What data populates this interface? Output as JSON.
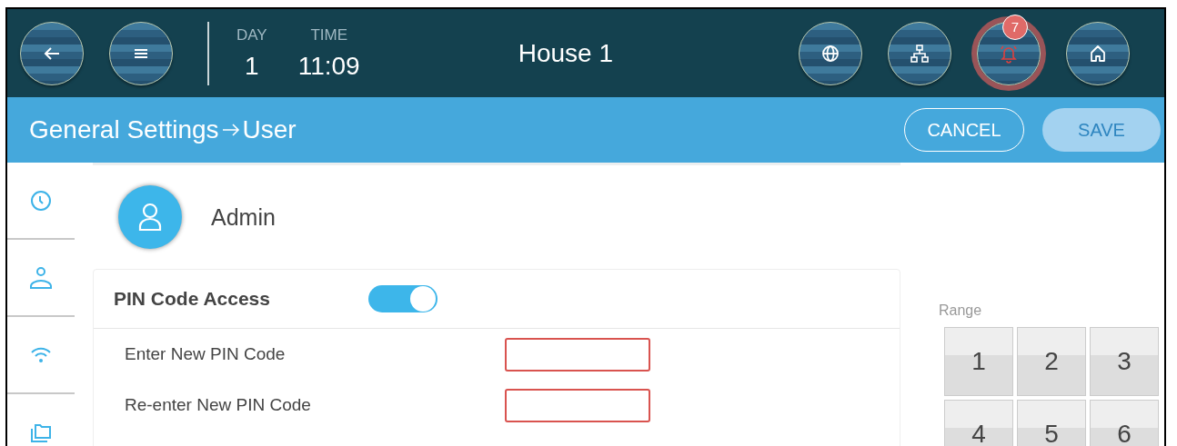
{
  "top_bar": {
    "day_label": "DAY",
    "day": "1",
    "time_label": "TIME",
    "time": "11:09",
    "title": "House 1",
    "alarm_badge": "7",
    "alarm_active": true
  },
  "header": {
    "breadcrumb": "General Settings",
    "page": "User",
    "cancel": "CANCEL",
    "save": "SAVE",
    "save_disabled": true
  },
  "sidebar": {
    "items": [
      {
        "kind": "clock"
      },
      {
        "kind": "user"
      },
      {
        "kind": "wifi"
      },
      {
        "kind": "folder"
      }
    ]
  },
  "user": {
    "name": "Admin"
  },
  "pin": {
    "title": "PIN Code Access",
    "on": true,
    "fields": [
      {
        "label": "Enter New PIN Code",
        "invalid": true
      },
      {
        "label": "Re-enter New PIN Code",
        "invalid": true
      }
    ]
  },
  "keypad": {
    "label": "Range",
    "keys": [
      "1",
      "2",
      "3",
      "4",
      "5",
      "6"
    ]
  }
}
